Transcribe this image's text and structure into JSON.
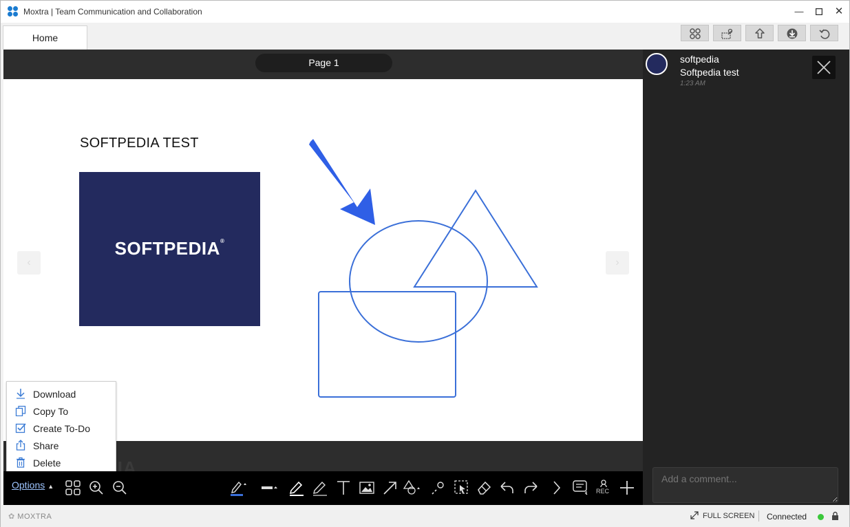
{
  "window": {
    "title": "Moxtra | Team Communication and Collaboration"
  },
  "tabs": [
    {
      "label": "Home"
    }
  ],
  "viewer": {
    "page_label": "Page 1",
    "slide_title": "SOFTPEDIA TEST",
    "logo_text": "SOFTPEDIA",
    "logo_mark": "®"
  },
  "options_menu": {
    "items": [
      {
        "label": "Download",
        "icon": "download-icon"
      },
      {
        "label": "Copy To",
        "icon": "copy-icon"
      },
      {
        "label": "Create To-Do",
        "icon": "todo-icon"
      },
      {
        "label": "Share",
        "icon": "share-icon"
      },
      {
        "label": "Delete",
        "icon": "trash-icon"
      }
    ]
  },
  "watermark": "SOFTPEDIA",
  "toolbar": {
    "options_label": "Options",
    "rec_label": "REC"
  },
  "side_panel": {
    "user": "softpedia",
    "message": "Softpedia test",
    "time": "1:23 AM",
    "comment_placeholder": "Add a comment..."
  },
  "statusbar": {
    "logo": "MOXTRA",
    "fullscreen_label": "FULL SCREEN",
    "connection_status": "Connected"
  },
  "colors": {
    "accent": "#3a6fd8",
    "logo_bg": "#232a5e",
    "connected": "#3bc83b"
  }
}
